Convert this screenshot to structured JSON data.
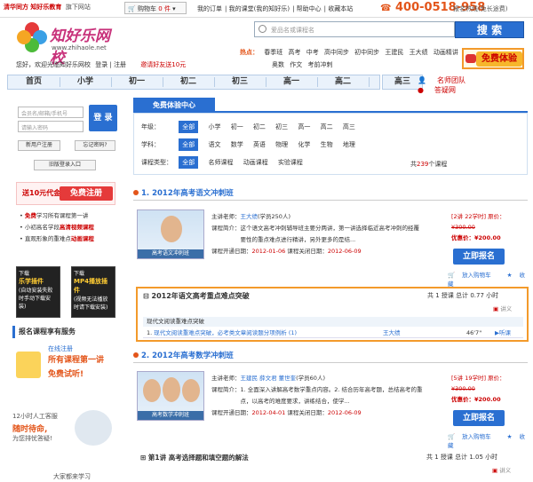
{
  "topbar": {
    "logo_left": "清华同方 知好乐教育",
    "logo_note": "旗下网站",
    "cart_label": "购物车",
    "cart_count": "0 件",
    "links": [
      "我的订单",
      "我的课堂(我的知好乐)",
      "帮助中心",
      "收藏本站"
    ],
    "phone": "400-0518-958",
    "phone_note": "报名热线(免长途费)"
  },
  "header": {
    "brand": "知好乐网校",
    "url": "www.zhihaole.net",
    "welcome": "您好，欢迎光临知好乐网校",
    "login_link": "登录",
    "register_link": "注册",
    "invite": "邀请好友送10元",
    "search_placeholder": "爱品名或课程名",
    "search_button": "搜 索",
    "hot_label": "热点：",
    "hot_items": [
      "春季班",
      "高考",
      "中考",
      "高中同步",
      "初中同步",
      "王建民",
      "王大绩",
      "动画精讲",
      "奥数",
      "作文",
      "考前冲刺"
    ],
    "free_exp": "免费体验"
  },
  "nav": {
    "items": [
      "首页",
      "小学",
      "初一",
      "初二",
      "初三",
      "高一",
      "高二",
      "高三"
    ],
    "right": [
      "名师团队",
      "答疑网"
    ]
  },
  "login": {
    "user_placeholder": "会员名/邮箱/手机号",
    "pass_placeholder": "请输入密码",
    "login_button": "登 录",
    "register_button": "新用户注册",
    "forgot_button": "忘记密码?",
    "old_login": "旧版登录入口"
  },
  "promo": {
    "amount": "送10元代金券",
    "register": "免费注册",
    "line1_red": "免费",
    "line1": "学习所有课程第一讲",
    "line2": "小初高名学段",
    "line2_red": "高清视频课程",
    "line3": "直观形象的重难点",
    "line3_red": "动画课程"
  },
  "plugins": [
    {
      "title": "下载",
      "name": "乐学插件",
      "desc": "(自动安装失败时手动下载安装)"
    },
    {
      "title": "下载",
      "name": "MP4播放插件",
      "desc": "(视频无法播放时请下载安装)"
    }
  ],
  "reg_service": {
    "title": "报名课程享有服务",
    "t1": "在线注册",
    "t2": "所有课程第一讲",
    "t3": "免费试听!",
    "s1": "12小时人工客服",
    "s2": "随时待命,",
    "s3": "为您排忧答疑!",
    "more": "大家都来学习"
  },
  "center": {
    "tab": "免费体验中心",
    "grade_label": "年级：",
    "grades": [
      "全部",
      "小学",
      "初一",
      "初二",
      "初三",
      "高一",
      "高二",
      "高三"
    ],
    "subject_label": "学科：",
    "subjects": [
      "全部",
      "语文",
      "数学",
      "英语",
      "物理",
      "化学",
      "生物",
      "地理"
    ],
    "type_label": "课程类型：",
    "types": [
      "全部",
      "名师课程",
      "动画课程",
      "实验课程"
    ],
    "total_prefix": "共",
    "total_count": "239",
    "total_suffix": "个课程"
  },
  "courses": [
    {
      "title": "1. 2012年高考语文冲刺班",
      "pic_caption": "高考语文冲刺班",
      "teacher_label": "主讲老师：",
      "teacher": "王大绩",
      "students": "(学员250人)",
      "intro_label": "课程简介：",
      "intro": "这个语文高考冲刺辅导班主要分两讲，第一讲选择临近高考冲刺的经覆要性的重点难点进行精讲，另外更多的是结...",
      "start_label": "课程开通日期：",
      "start": "2012-01-06",
      "end_label": "课程关闭日期：",
      "end": "2012-06-09",
      "lectures": "[2讲 22学时] 原价：",
      "orig_price": "¥300.00",
      "sale_label": "优惠价：",
      "sale_price": "¥200.00",
      "buy": "立即报名",
      "cart": "放入购物车",
      "fav": "收藏"
    },
    {
      "title": "2. 2012年高考数学冲刺班",
      "pic_caption": "高考数学冲刺班",
      "teacher_label": "主讲老师：",
      "teacher": "王建民 薛文君 董世奎",
      "students": "(学员60人)",
      "intro_label": "课程简介：",
      "intro": "1. 全面深入讲解高考数学重点内容。2. 结合历年高考题，总结高考的重点，以高考的难度要求，讲练结合，使学...",
      "start_label": "课程开通日期：",
      "start": "2012-04-01",
      "end_label": "课程关闭日期：",
      "end": "2012-06-09",
      "lectures": "[5讲 19学时] 原价：",
      "orig_price": "¥300.00",
      "sale_label": "优惠价：",
      "sale_price": "¥200.00",
      "buy": "立即报名",
      "cart": "放入购物车",
      "fav": "收藏"
    }
  ],
  "highlight": {
    "title": "2012年语文高考重点难点突破",
    "meta": "共 1 授课  总计 0.77 小时",
    "lecture": "讲义",
    "sub": "现代文阅读重难点突破",
    "row_index": "1.",
    "row_title": "现代文阅读重难点突破，必考类文章阅读题分项例析 (1)",
    "row_teacher": "王大绩",
    "row_time": "46'7\"",
    "row_action": "听课"
  },
  "bottom": {
    "title": "第1讲 高考选择题和填空题的解法",
    "meta": "共 1 授课  总计 1.05 小时",
    "lecture": "讲义"
  }
}
